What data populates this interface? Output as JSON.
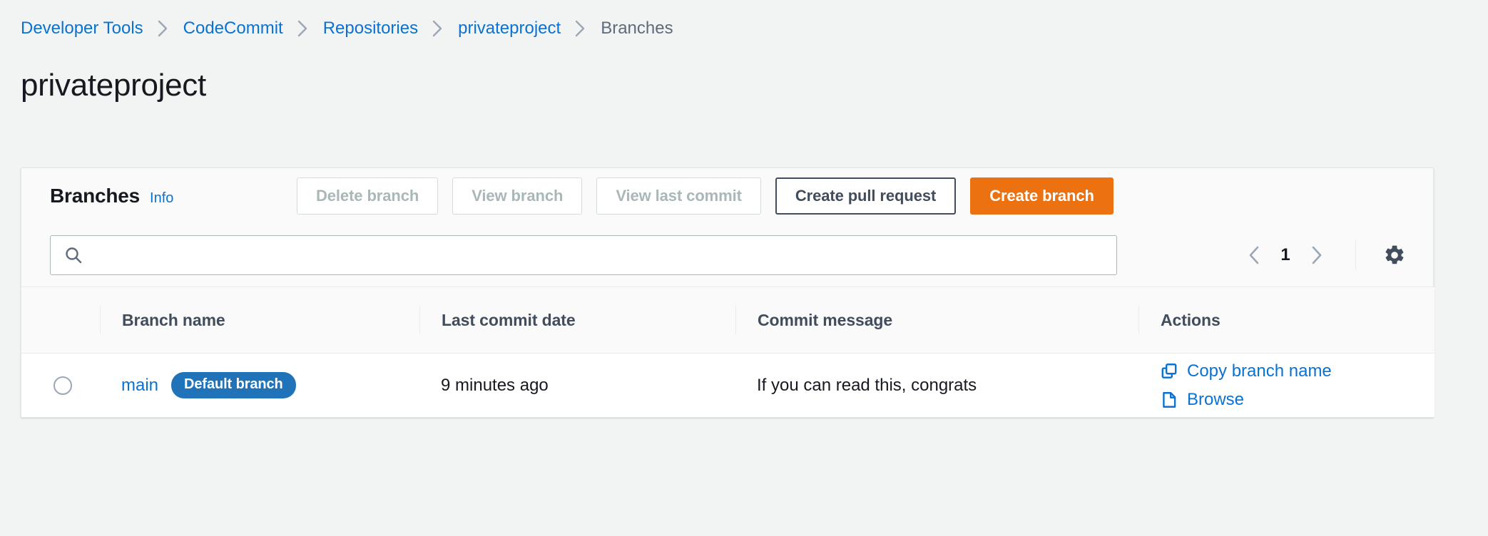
{
  "breadcrumb": {
    "items": [
      {
        "label": "Developer Tools",
        "current": false
      },
      {
        "label": "CodeCommit",
        "current": false
      },
      {
        "label": "Repositories",
        "current": false
      },
      {
        "label": "privateproject",
        "current": false
      },
      {
        "label": "Branches",
        "current": true
      }
    ],
    "separator_icon": "chevron-right-icon"
  },
  "page": {
    "title": "privateproject"
  },
  "panel": {
    "header": {
      "title": "Branches",
      "info_label": "Info",
      "buttons": [
        {
          "label": "Delete branch",
          "variant": "disabled"
        },
        {
          "label": "View branch",
          "variant": "disabled"
        },
        {
          "label": "View last commit",
          "variant": "disabled"
        },
        {
          "label": "Create pull request",
          "variant": "normal"
        },
        {
          "label": "Create branch",
          "variant": "primary"
        }
      ]
    },
    "search": {
      "value": "",
      "placeholder": "",
      "icon": "search-icon"
    },
    "pagination": {
      "prev_icon": "chevron-left-icon",
      "next_icon": "chevron-right-icon",
      "current_page": "1",
      "prev_enabled": false,
      "next_enabled": false,
      "settings_icon": "gear-icon"
    },
    "table": {
      "columns": [
        {
          "label": ""
        },
        {
          "label": "Branch name"
        },
        {
          "label": "Last commit date"
        },
        {
          "label": "Commit message"
        },
        {
          "label": "Actions"
        }
      ],
      "rows": [
        {
          "selected": false,
          "branch_name": "main",
          "badge": "Default branch",
          "last_commit_date": "9 minutes ago",
          "commit_message": "If you can read this, congrats",
          "actions": [
            {
              "label": "Copy branch name",
              "icon": "copy-icon"
            },
            {
              "label": "Browse",
              "icon": "file-icon"
            }
          ]
        }
      ]
    }
  },
  "colors": {
    "link": "#0972d3",
    "primary_button": "#ec7211",
    "badge": "#2073b8",
    "page_background": "#f2f3f3",
    "panel_header_background": "#fafafa",
    "text": "#16191f",
    "muted_text": "#5f6b7a",
    "disabled_text": "#aab7b8"
  }
}
